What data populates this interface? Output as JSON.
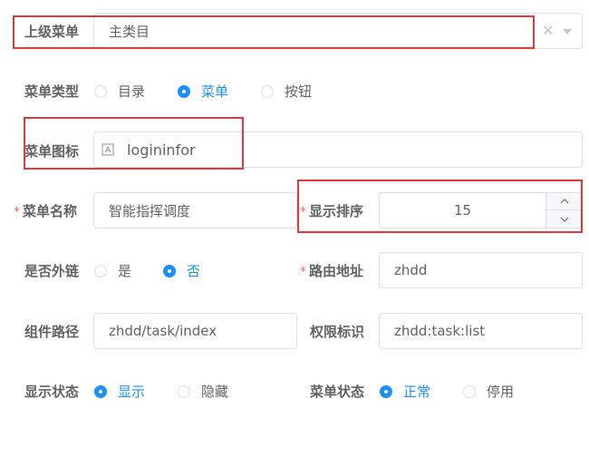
{
  "parent_menu": {
    "label": "上级菜单",
    "value": "主类目"
  },
  "menu_type": {
    "label": "菜单类型",
    "options": [
      {
        "label": "目录",
        "checked": false
      },
      {
        "label": "菜单",
        "checked": true
      },
      {
        "label": "按钮",
        "checked": false
      }
    ]
  },
  "menu_icon": {
    "label": "菜单图标",
    "value": "logininfor"
  },
  "menu_name": {
    "label": "菜单名称",
    "value": "智能指挥调度"
  },
  "display_order": {
    "label": "显示排序",
    "value": "15"
  },
  "external_link": {
    "label": "是否外链",
    "options": [
      {
        "label": "是",
        "checked": false
      },
      {
        "label": "否",
        "checked": true
      }
    ]
  },
  "route_address": {
    "label": "路由地址",
    "value": "zhdd"
  },
  "component_path": {
    "label": "组件路径",
    "value": "zhdd/task/index"
  },
  "permission": {
    "label": "权限标识",
    "value": "zhdd:task:list"
  },
  "display_status": {
    "label": "显示状态",
    "options": [
      {
        "label": "显示",
        "checked": true
      },
      {
        "label": "隐藏",
        "checked": false
      }
    ]
  },
  "menu_status": {
    "label": "菜单状态",
    "options": [
      {
        "label": "正常",
        "checked": true
      },
      {
        "label": "停用",
        "checked": false
      }
    ]
  },
  "colors": {
    "primary": "#1890ff",
    "required": "#f56c6c",
    "highlight": "#e53935"
  },
  "icons": [
    "clear-icon",
    "chevron-down-icon",
    "image-icon",
    "chevron-up-icon"
  ]
}
